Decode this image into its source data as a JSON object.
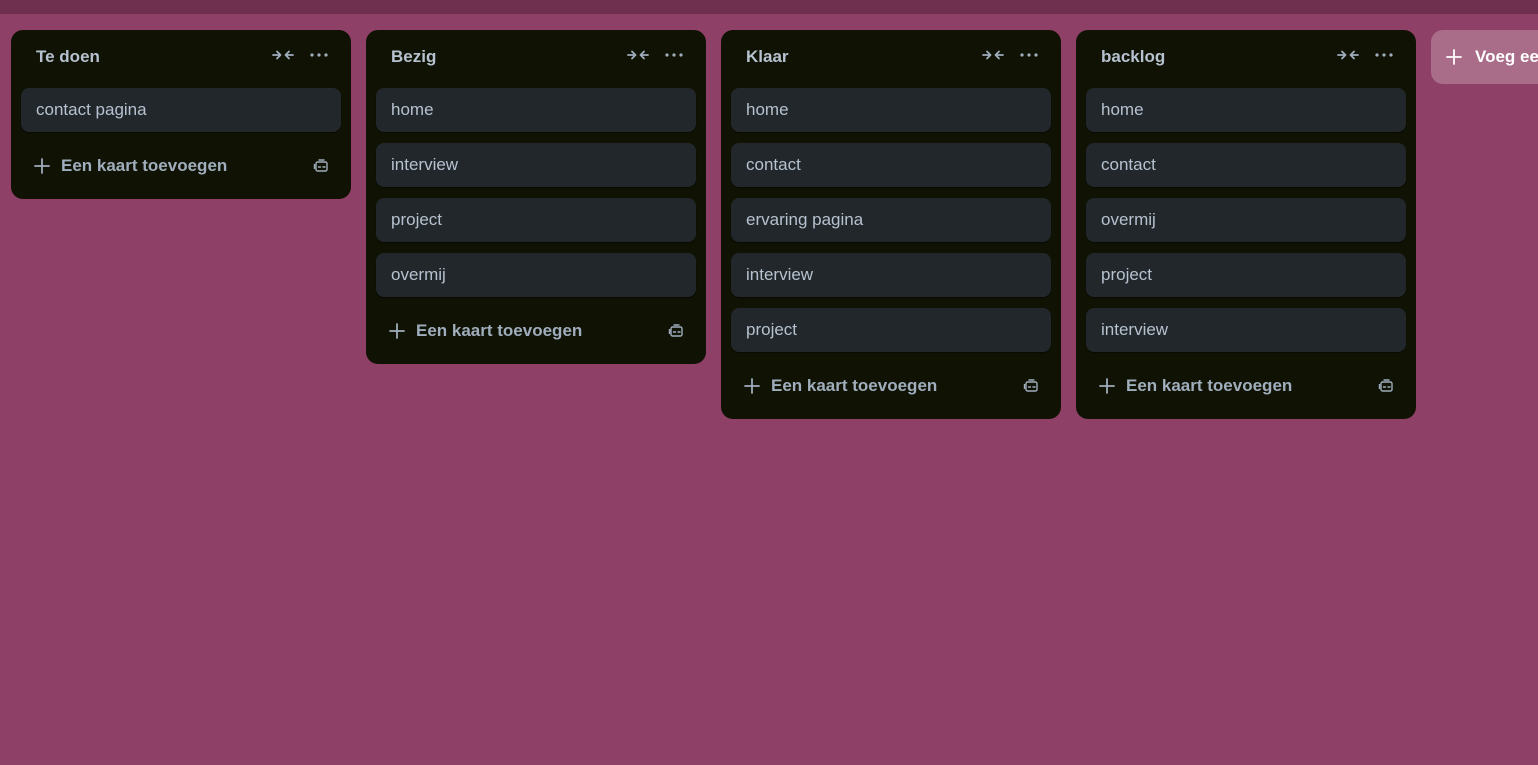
{
  "colors": {
    "background": "#8f4066",
    "list_bg": "#101204",
    "card_bg": "#22272b",
    "text": "#b6c2cf"
  },
  "icons": {
    "collapse": "collapse-arrows-icon",
    "more": "more-dots-icon",
    "plus": "plus-icon",
    "template": "card-template-icon"
  },
  "lists": [
    {
      "title": "Te doen",
      "cards": [
        "contact pagina"
      ],
      "add_label": "Een kaart toevoegen"
    },
    {
      "title": "Bezig",
      "cards": [
        "home",
        "interview",
        "project",
        "overmij"
      ],
      "add_label": "Een kaart toevoegen"
    },
    {
      "title": "Klaar",
      "cards": [
        "home",
        "contact",
        "ervaring pagina",
        "interview",
        "project"
      ],
      "add_label": "Een kaart toevoegen"
    },
    {
      "title": "backlog",
      "cards": [
        "home",
        "contact",
        "overmij",
        "project",
        "interview"
      ],
      "add_label": "Een kaart toevoegen"
    }
  ],
  "add_list_label": "Voeg ee"
}
